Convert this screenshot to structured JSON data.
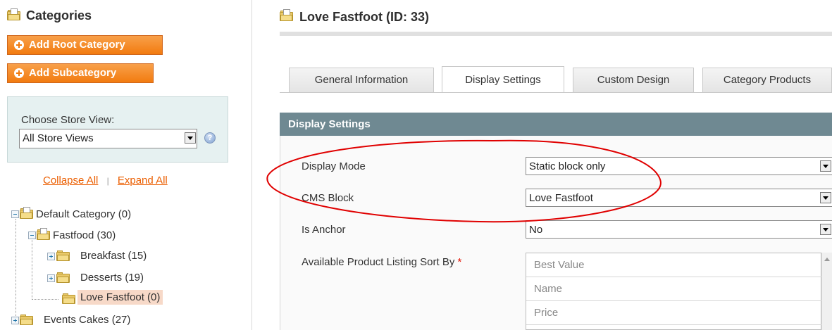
{
  "sidebar": {
    "title": "Categories",
    "add_root_label": "Add Root Category",
    "add_sub_label": "Add Subcategory",
    "store_view_label": "Choose Store View:",
    "store_view_value": "All Store Views",
    "help_glyph": "?",
    "collapse_all": "Collapse All",
    "separator": "|",
    "expand_all": "Expand All",
    "tree": [
      {
        "label": "Default Category (0)"
      },
      {
        "label": "Fastfood (30)"
      },
      {
        "label": "Breakfast (15)"
      },
      {
        "label": "Desserts (19)"
      },
      {
        "label": "Love Fastfoot (0)",
        "selected": true
      },
      {
        "label": "Events Cakes (27)"
      }
    ]
  },
  "main": {
    "title": "Love Fastfoot (ID: 33)",
    "tabs": [
      {
        "label": "General Information"
      },
      {
        "label": "Display Settings",
        "active": true
      },
      {
        "label": "Custom Design"
      },
      {
        "label": "Category Products"
      }
    ],
    "section_title": "Display Settings",
    "fields": {
      "display_mode_label": "Display Mode",
      "display_mode_value": "Static block only",
      "cms_block_label": "CMS Block",
      "cms_block_value": "Love Fastfoot",
      "is_anchor_label": "Is Anchor",
      "is_anchor_value": "No",
      "sort_by_label": "Available Product Listing Sort By",
      "required_mark": "*",
      "sort_by_options": [
        "Best Value",
        "Name",
        "Price"
      ]
    }
  },
  "colors": {
    "accent_orange": "#f78b1f",
    "section_header": "#6f8992",
    "annotation_red": "#e00000",
    "selected_bg": "#f7d9c8"
  }
}
